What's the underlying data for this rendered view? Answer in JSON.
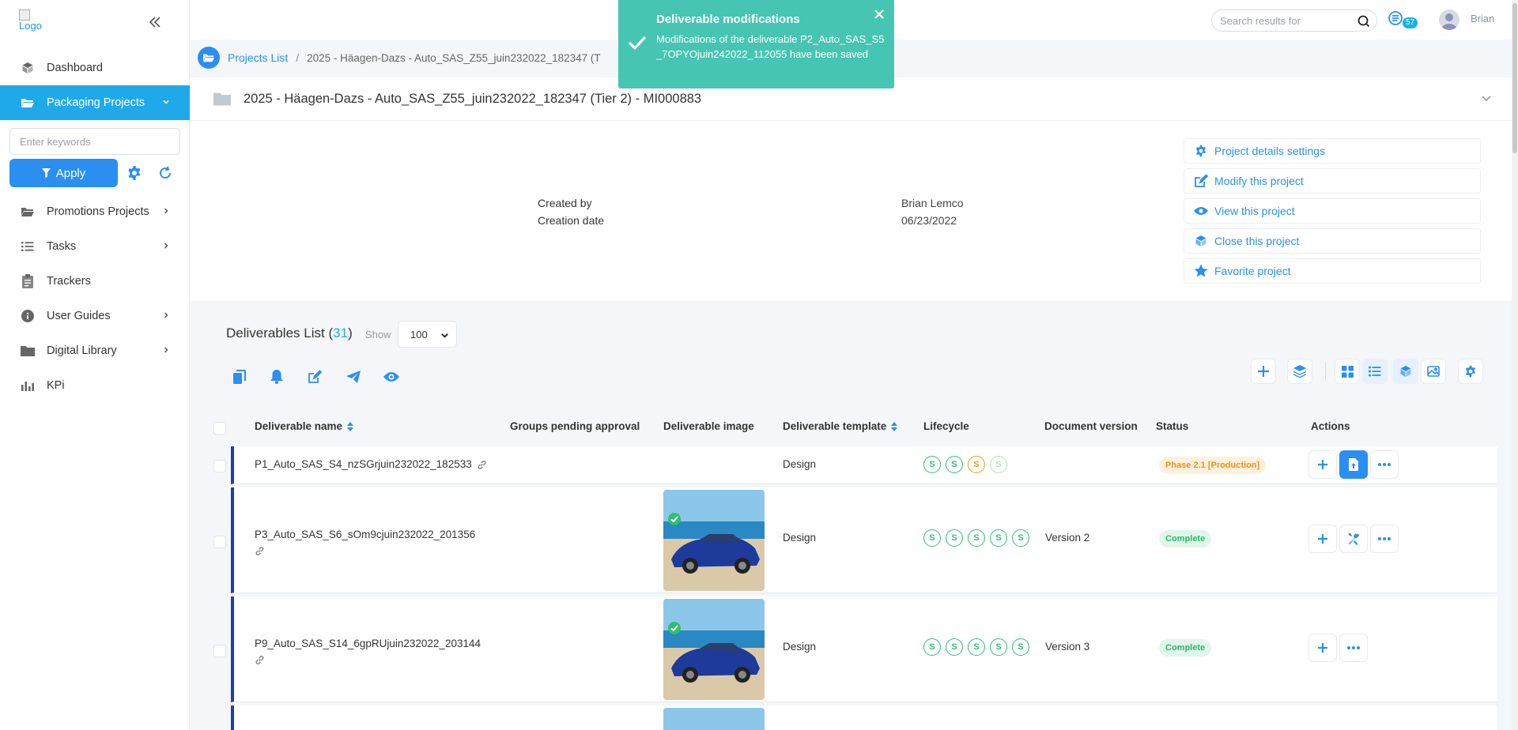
{
  "sidebar": {
    "logo_alt": "Logo",
    "items": [
      {
        "label": "Dashboard"
      },
      {
        "label": "Packaging Projects"
      },
      {
        "label": "Promotions Projects"
      },
      {
        "label": "Tasks"
      },
      {
        "label": "Trackers"
      },
      {
        "label": "User Guides"
      },
      {
        "label": "Digital Library"
      },
      {
        "label": "KPi"
      }
    ],
    "keyword_placeholder": "Enter keywords",
    "apply_label": "Apply"
  },
  "topbar": {
    "search_placeholder": "Search results for",
    "notif_count": "57",
    "user_name": "Brian"
  },
  "breadcrumb": {
    "link": "Projects List",
    "separator": "/",
    "current": "2025 - Häagen-Dazs - Auto_SAS_Z55_juin232022_182347 (T"
  },
  "project": {
    "title": "2025 - Häagen-Dazs - Auto_SAS_Z55_juin232022_182347 (Tier 2) - MI000883",
    "created_by_label": "Created by",
    "created_by_value": "Brian Lemco",
    "creation_date_label": "Creation date",
    "creation_date_value": "06/23/2022",
    "actions": [
      {
        "label": "Project details settings",
        "icon": "gear-icon"
      },
      {
        "label": "Modify this project",
        "icon": "edit-icon"
      },
      {
        "label": "View this project",
        "icon": "eye-icon"
      },
      {
        "label": "Close this project",
        "icon": "box-icon"
      },
      {
        "label": "Favorite project",
        "icon": "star-icon"
      }
    ]
  },
  "deliverables": {
    "title": "Deliverables List",
    "count_open": "(",
    "count": "31",
    "count_close": ")",
    "show_label": "Show",
    "show_value": "100",
    "columns": {
      "name": "Deliverable name",
      "groups": "Groups pending approval",
      "image": "Deliverable image",
      "template": "Deliverable template",
      "lifecycle": "Lifecycle",
      "version": "Document version",
      "status": "Status",
      "actions": "Actions"
    },
    "rows": [
      {
        "name": "P1_Auto_SAS_S4_nzSGrjuin232022_182533",
        "template": "Design",
        "version": "",
        "status": "Phase 2.1 [Production]"
      },
      {
        "name": "P3_Auto_SAS_S6_sOm9cjuin232022_201356",
        "template": "Design",
        "version": "Version 2",
        "status": "Complete"
      },
      {
        "name": "P9_Auto_SAS_S14_6gpRUjuin232022_203144",
        "template": "Design",
        "version": "Version 3",
        "status": "Complete"
      }
    ],
    "lifecycle_letter": "S"
  },
  "toast": {
    "title": "Deliverable modifications",
    "message": "Modifications of the deliverable P2_Auto_SAS_S5_7OPYOjuin242022_112055 have been saved"
  },
  "colors": {
    "primary": "#2a8ff0",
    "active_nav": "#1fa9e8",
    "toast": "#46c5b2",
    "row_accent": "#1e3fa8",
    "complete": "#2bb86c",
    "phase": "#e8931d"
  }
}
